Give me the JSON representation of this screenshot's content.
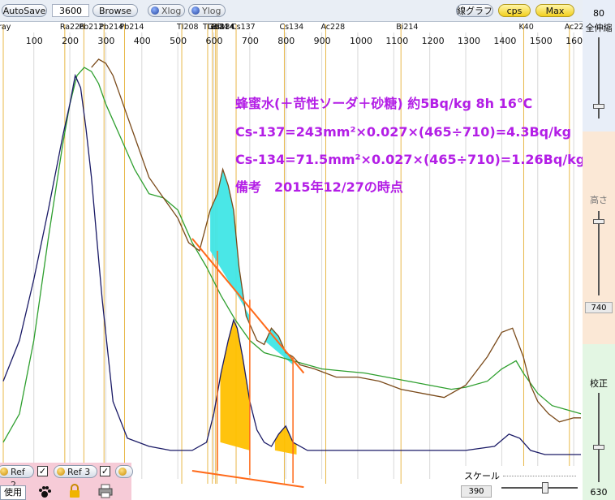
{
  "toolbar": {
    "autosave": "AutoSave",
    "time_value": "3600",
    "browse": "Browse",
    "xlog": "Xlog",
    "ylog": "Ylog",
    "line_graph": "線グラフ",
    "cps": "cps",
    "max": "Max"
  },
  "right_panel": {
    "top_value": "80",
    "label_expand": "全伸縮",
    "label_height": "高さ",
    "height_value": "740",
    "label_calib": "校正",
    "calib_value": "630"
  },
  "bottom": {
    "ref2": "Ref 2",
    "ref3": "Ref 3",
    "use": "使用",
    "scale_label": "スケール",
    "scale_value": "390"
  },
  "annotations": {
    "line1": "蜂蜜水(＋苛性ソーダ＋砂糖) 約5Bq/kg 8h 16℃",
    "line2": "Cs-137=243mm²×0.027×(465÷710)=4.3Bq/kg",
    "line3": "Cs-134=71.5mm²×0.027×(465÷710)=1.26Bq/kg",
    "line4": "備考　2015年12/27の時点"
  },
  "colors": {
    "background_series": "#2e9f2e",
    "sample_series": "#7a4a1a",
    "difference_series": "#1a1a66",
    "peak_fill_upper": "#40e6e6",
    "peak_fill_lower": "#ffc000",
    "baseline": "#ff6a1a",
    "nuclide_line": "#e8b84a",
    "annotation_text": "#b31ee6"
  },
  "chart_data": {
    "type": "line",
    "title": "",
    "xlabel": "",
    "ylabel": "",
    "xlim": [
      15,
      1620
    ],
    "x_ticks": [
      100,
      200,
      300,
      400,
      500,
      600,
      700,
      800,
      900,
      1000,
      1100,
      1200,
      1300,
      1400,
      1500,
      1600
    ],
    "x_tick_labels": [
      "100",
      "200",
      "300",
      "400",
      "500",
      "600",
      "700",
      "800",
      "900",
      "1000",
      "1100",
      "1200",
      "1300",
      "1400",
      "1500",
      "1600"
    ],
    "nuclide_markers": [
      {
        "label": "ray",
        "x": 15
      },
      {
        "label": "Ra226",
        "x": 186
      },
      {
        "label": "Pb212",
        "x": 239
      },
      {
        "label": "Pb214",
        "x": 295
      },
      {
        "label": "Pb214",
        "x": 352
      },
      {
        "label": "Ge74",
        "x": 596
      },
      {
        "label": "Tl208",
        "x": 583
      },
      {
        "label": "Tl208",
        "x": 511
      },
      {
        "label": "Bi214",
        "x": 609
      },
      {
        "label": "Cs134",
        "x": 605
      },
      {
        "label": "Cs137",
        "x": 662
      },
      {
        "label": "Cs134",
        "x": 796
      },
      {
        "label": "Ac228",
        "x": 911
      },
      {
        "label": "Bi214",
        "x": 1120
      },
      {
        "label": "K40",
        "x": 1461
      },
      {
        "label": "Ac228",
        "x": 1588
      }
    ],
    "series": [
      {
        "name": "",
        "color": "#2e9f2e",
        "x": [
          15,
          60,
          100,
          140,
          180,
          200,
          220,
          240,
          260,
          280,
          300,
          340,
          380,
          420,
          460,
          500,
          540,
          580,
          620,
          660,
          700,
          740,
          780,
          820,
          860,
          900,
          960,
          1020,
          1080,
          1140,
          1200,
          1260,
          1300,
          1360,
          1400,
          1440,
          1460,
          1500,
          1540,
          1580,
          1620
        ],
        "y": [
          0.05,
          0.12,
          0.3,
          0.55,
          0.78,
          0.88,
          0.95,
          0.97,
          0.96,
          0.93,
          0.88,
          0.8,
          0.72,
          0.66,
          0.65,
          0.62,
          0.54,
          0.48,
          0.41,
          0.35,
          0.3,
          0.27,
          0.26,
          0.25,
          0.24,
          0.23,
          0.225,
          0.22,
          0.21,
          0.2,
          0.19,
          0.18,
          0.185,
          0.2,
          0.23,
          0.25,
          0.22,
          0.17,
          0.14,
          0.13,
          0.12
        ]
      },
      {
        "name": "",
        "color": "#7a4a1a",
        "x": [
          260,
          280,
          300,
          320,
          340,
          360,
          380,
          420,
          460,
          500,
          530,
          560,
          590,
          610,
          625,
          640,
          655,
          670,
          690,
          720,
          740,
          760,
          780,
          800,
          820,
          840,
          880,
          940,
          1000,
          1060,
          1120,
          1180,
          1240,
          1300,
          1360,
          1400,
          1430,
          1460,
          1480,
          1500,
          1530,
          1560,
          1600,
          1620
        ],
        "y": [
          0.97,
          0.99,
          0.98,
          0.95,
          0.9,
          0.85,
          0.8,
          0.7,
          0.65,
          0.6,
          0.54,
          0.52,
          0.62,
          0.66,
          0.72,
          0.68,
          0.62,
          0.48,
          0.36,
          0.3,
          0.29,
          0.33,
          0.31,
          0.27,
          0.26,
          0.24,
          0.23,
          0.21,
          0.21,
          0.2,
          0.18,
          0.17,
          0.16,
          0.19,
          0.26,
          0.32,
          0.33,
          0.26,
          0.19,
          0.15,
          0.12,
          0.1,
          0.11,
          0.11
        ]
      },
      {
        "name": "",
        "color": "#1a1a66",
        "x": [
          15,
          60,
          100,
          140,
          180,
          200,
          215,
          230,
          245,
          260,
          275,
          290,
          320,
          360,
          420,
          480,
          540,
          580,
          600,
          620,
          640,
          655,
          665,
          680,
          700,
          720,
          740,
          760,
          780,
          800,
          820,
          860,
          940,
          1060,
          1200,
          1300,
          1380,
          1420,
          1450,
          1480,
          1520,
          1620
        ],
        "y": [
          0.2,
          0.3,
          0.45,
          0.62,
          0.8,
          0.88,
          0.95,
          0.92,
          0.82,
          0.7,
          0.55,
          0.4,
          0.15,
          0.06,
          0.04,
          0.03,
          0.03,
          0.05,
          0.12,
          0.22,
          0.3,
          0.35,
          0.33,
          0.26,
          0.15,
          0.08,
          0.05,
          0.04,
          0.07,
          0.09,
          0.05,
          0.03,
          0.03,
          0.03,
          0.03,
          0.03,
          0.04,
          0.07,
          0.06,
          0.03,
          0.02,
          0.02
        ]
      }
    ]
  }
}
